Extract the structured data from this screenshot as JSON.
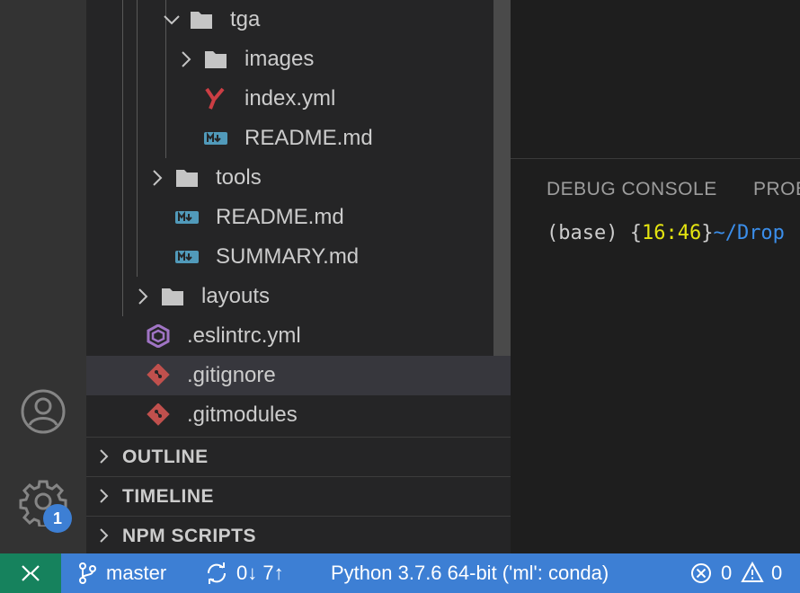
{
  "explorer": {
    "rows": [
      {
        "label": "tga",
        "kind": "folder-open",
        "icon": "folder-icon"
      },
      {
        "label": "images",
        "kind": "folder-closed",
        "icon": "folder-icon"
      },
      {
        "label": "index.yml",
        "kind": "file",
        "icon": "yaml-file-icon"
      },
      {
        "label": "README.md",
        "kind": "file",
        "icon": "markdown-file-icon"
      },
      {
        "label": "tools",
        "kind": "folder-closed",
        "icon": "folder-icon"
      },
      {
        "label": "README.md",
        "kind": "file",
        "icon": "markdown-file-icon"
      },
      {
        "label": "SUMMARY.md",
        "kind": "file",
        "icon": "markdown-file-icon"
      },
      {
        "label": "layouts",
        "kind": "folder-closed",
        "icon": "folder-icon"
      },
      {
        "label": ".eslintrc.yml",
        "kind": "file",
        "icon": "eslint-file-icon"
      },
      {
        "label": ".gitignore",
        "kind": "file",
        "icon": "git-file-icon",
        "selected": true
      },
      {
        "label": ".gitmodules",
        "kind": "file",
        "icon": "git-file-icon"
      }
    ]
  },
  "sections": {
    "outline": "OUTLINE",
    "timeline": "TIMELINE",
    "npm_scripts": "NPM SCRIPTS"
  },
  "activity": {
    "badge": "1",
    "icons": [
      "account-icon",
      "gear-icon"
    ]
  },
  "panel": {
    "tabs": {
      "debug_console": "DEBUG CONSOLE",
      "problems": "PROBL"
    },
    "terminal": {
      "prefix": "(base) {",
      "time": "16:46",
      "suffix": "}",
      "path": "~/Drop"
    }
  },
  "status": {
    "branch": "master",
    "sync": "0↓ 7↑",
    "python": "Python 3.7.6 64-bit ('ml': conda)",
    "errors": "0",
    "warnings": "0"
  },
  "colors": {
    "status_bar": "#3d7fd4",
    "remote": "#16825d",
    "terminal_time": "#e5e510",
    "terminal_path": "#3b8eea",
    "yaml_icon": "#cc3e44",
    "markdown_icon": "#519aba",
    "eslint_icon": "#a074c4",
    "git_icon": "#c0504d"
  }
}
